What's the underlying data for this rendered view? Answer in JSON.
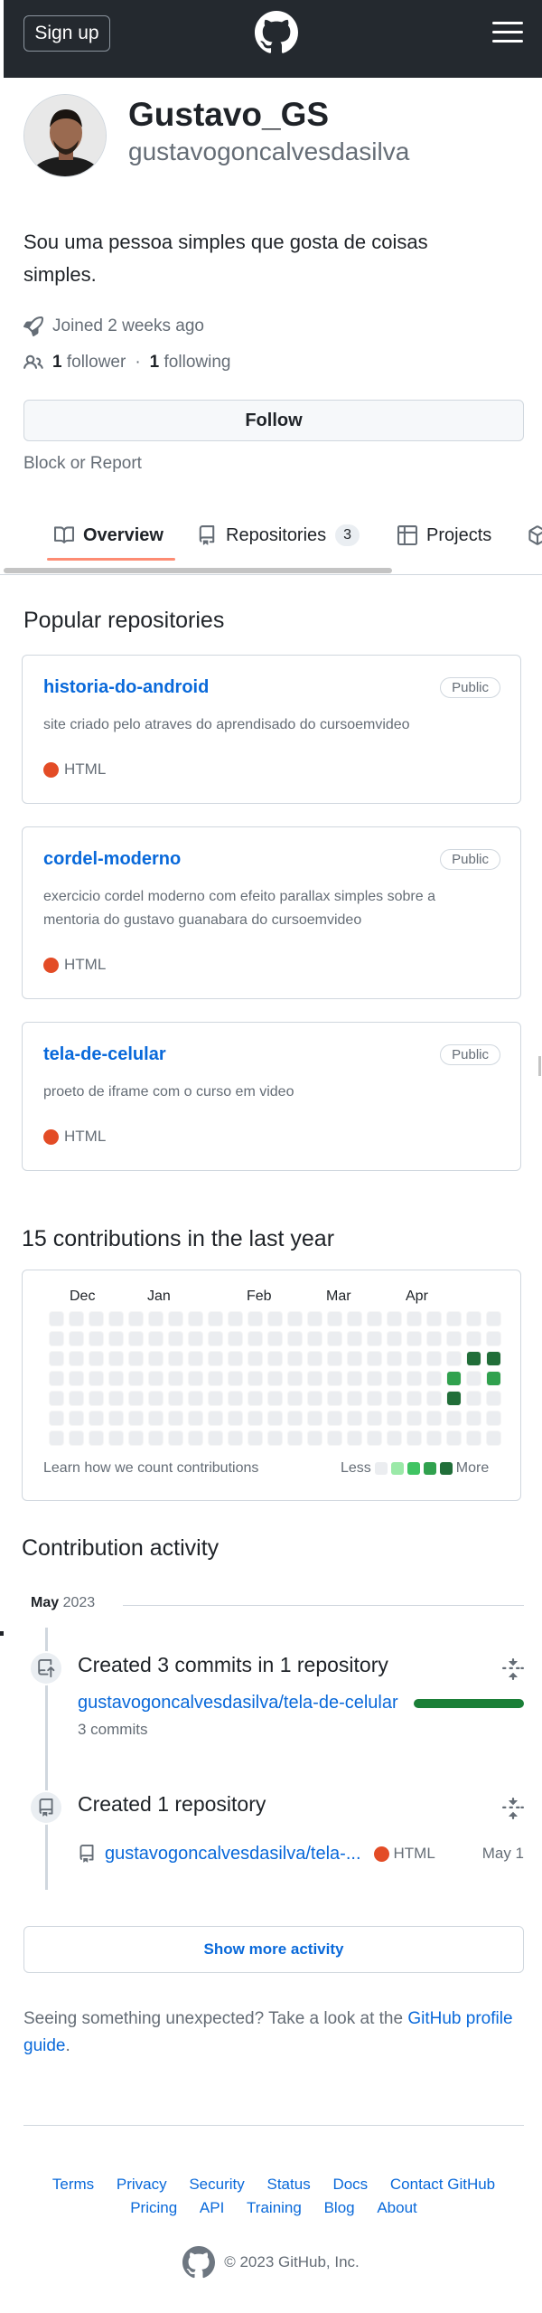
{
  "header": {
    "signup_label": "Sign up",
    "logo_icon": "github-mark-icon",
    "menu_icon": "hamburger-menu-icon",
    "background": "#24292f"
  },
  "profile": {
    "name": "Gustavo_GS",
    "login": "gustavogoncalvesdasilva",
    "bio": "Sou uma pessoa simples que gosta de coisas simples.",
    "joined": "Joined 2 weeks ago",
    "followers_count": "1",
    "followers_label": "follower",
    "separator": "·",
    "following_count": "1",
    "following_label": "following",
    "follow_label": "Follow",
    "block_label": "Block or Report"
  },
  "tabs": [
    {
      "label": "Overview",
      "icon": "book-icon",
      "selected": true
    },
    {
      "label": "Repositories",
      "icon": "repo-icon",
      "counter": "3"
    },
    {
      "label": "Projects",
      "icon": "table-icon"
    }
  ],
  "popular": {
    "title": "Popular repositories",
    "repos": [
      {
        "name": "historia-do-android",
        "visibility": "Public",
        "description": "site criado pelo atraves do aprendisado do cursoemvideo",
        "language": "HTML"
      },
      {
        "name": "cordel-moderno",
        "visibility": "Public",
        "description": "exercicio cordel moderno com efeito parallax simples sobre a mentoria do gustavo guanabara do cursoemvideo",
        "language": "HTML"
      },
      {
        "name": "tela-de-celular",
        "visibility": "Public",
        "description": "proeto de iframe com o curso em video",
        "language": "HTML"
      }
    ],
    "language_color": "#e34c26"
  },
  "contributions": {
    "title": "15 contributions in the last year",
    "months": [
      "Dec",
      "Jan",
      "Feb",
      "Mar",
      "Apr"
    ],
    "learn_label": "Learn how we count contributions",
    "less_label": "Less",
    "more_label": "More",
    "levels": [
      "#ebedf0",
      "#9be9a8",
      "#40c463",
      "#30a14e",
      "#216e39"
    ],
    "active_cells": [
      {
        "week": 21,
        "day": 2,
        "level": 4
      },
      {
        "week": 22,
        "day": 2,
        "level": 4
      },
      {
        "week": 20,
        "day": 3,
        "level": 3
      },
      {
        "week": 22,
        "day": 3,
        "level": 3
      },
      {
        "week": 20,
        "day": 4,
        "level": 4
      }
    ]
  },
  "activity": {
    "title": "Contribution activity",
    "month": "May",
    "year": "2023",
    "commits": {
      "title": "Created 3 commits in 1 repository",
      "repo": "gustavogoncalvesdasilva/tela-de-celular",
      "count": "3 commits",
      "bar_color": "#1a7f37"
    },
    "created": {
      "title": "Created 1 repository",
      "repo": "gustavogoncalvesdasilva/tela-...",
      "language": "HTML",
      "date": "May 1"
    },
    "show_more": "Show more activity"
  },
  "notice": {
    "text": "Seeing something unexpected? Take a look at the",
    "link": "GitHub profile guide",
    "end": "."
  },
  "footer": {
    "row1": [
      "Terms",
      "Privacy",
      "Security",
      "Status",
      "Docs",
      "Contact GitHub"
    ],
    "row2": [
      "Pricing",
      "API",
      "Training",
      "Blog",
      "About"
    ],
    "copyright": "© 2023 GitHub, Inc."
  }
}
